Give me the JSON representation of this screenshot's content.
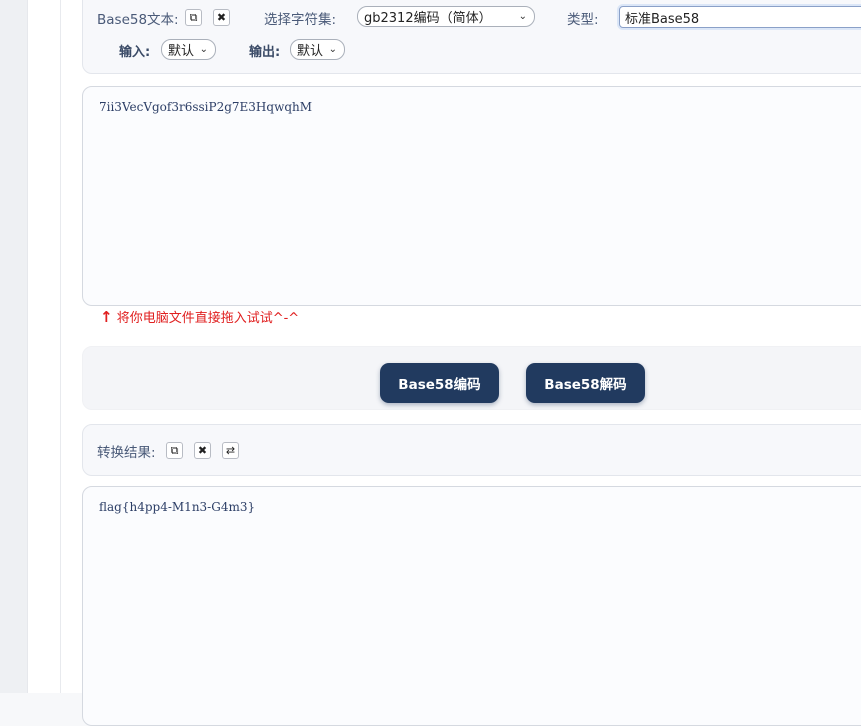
{
  "options": {
    "base58_text_label": "Base58文本:",
    "charset_label": "选择字符集:",
    "charset_value": "gb2312编码（简体）",
    "type_label": "类型:",
    "type_value": "标准Base58",
    "input_label": "输入:",
    "input_value": "默认",
    "output_label": "输出:",
    "output_value": "默认"
  },
  "input_text": "7ii3VecVgof3r6ssiP2g7E3HqwqhM",
  "drag_hint": {
    "arrow": "↑",
    "text": "将你电脑文件直接拖入试试^-^"
  },
  "buttons": {
    "encode": "Base58编码",
    "decode": "Base58解码"
  },
  "result": {
    "label": "转换结果:"
  },
  "output_text": "flag{h4pp4-M1n3-G4m3}",
  "icons": {
    "copy": "⧉",
    "clear": "✖",
    "swap": "⇄",
    "chevron": "⌄"
  },
  "colors": {
    "button_bg": "#213a5f",
    "hint_red": "#e02020"
  }
}
